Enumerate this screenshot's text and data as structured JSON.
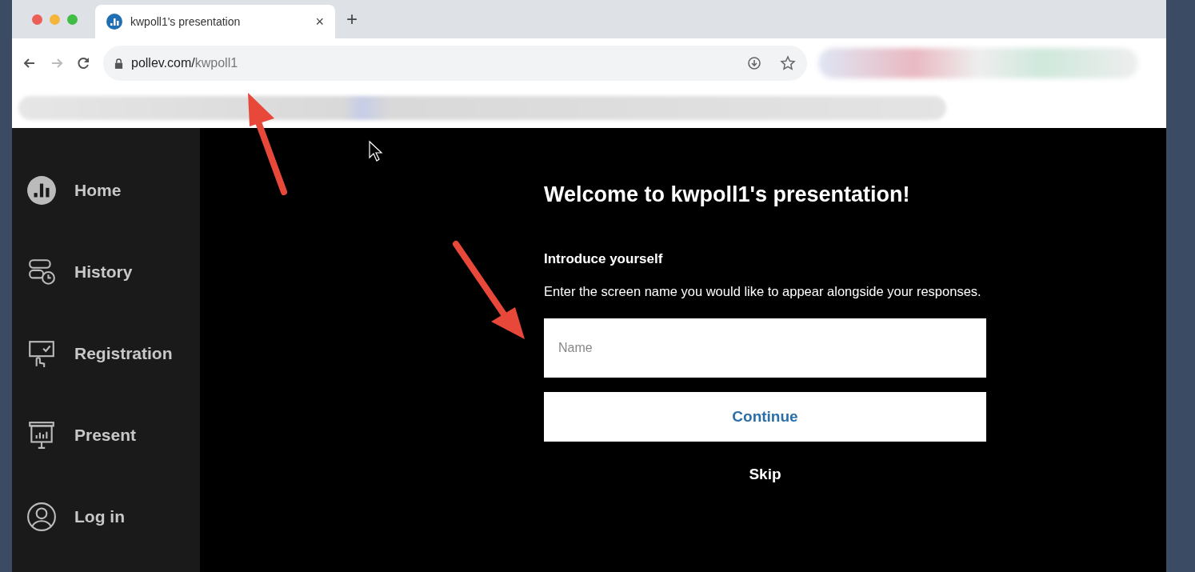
{
  "browser": {
    "tab": {
      "title": "kwpoll1's presentation",
      "close": "×"
    },
    "new_tab": "+",
    "address": {
      "host": "pollev.com/",
      "path": "kwpoll1"
    }
  },
  "sidebar": {
    "items": [
      {
        "label": "Home",
        "kind": "home"
      },
      {
        "label": "History",
        "kind": "history"
      },
      {
        "label": "Registration",
        "kind": "registration"
      },
      {
        "label": "Present",
        "kind": "present"
      },
      {
        "label": "Log in",
        "kind": "login"
      }
    ]
  },
  "main": {
    "heading": "Welcome to kwpoll1's presentation!",
    "subheading": "Introduce yourself",
    "description": "Enter the screen name you would like to appear alongside your responses.",
    "name_field": {
      "placeholder": "Name"
    },
    "continue_button": "Continue",
    "skip_link": "Skip"
  }
}
